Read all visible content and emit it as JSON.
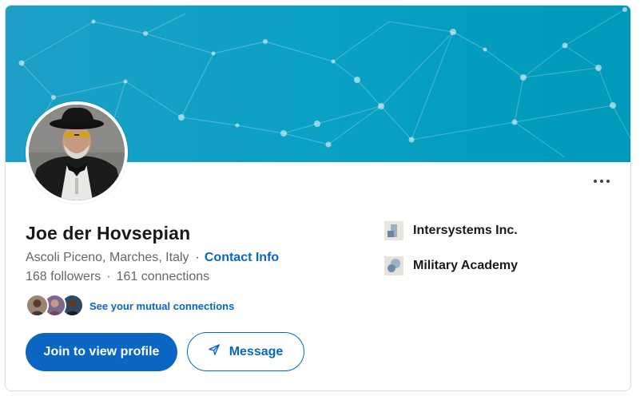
{
  "profile": {
    "name": "Joe der Hovsepian",
    "location": "Ascoli Piceno, Marches, Italy",
    "contact_info_label": "Contact Info",
    "followers": "168 followers",
    "connections": "161 connections",
    "mutual_connections_label": "See your mutual connections"
  },
  "actions": {
    "join_label": "Join to view profile",
    "message_label": "Message",
    "more_label": "More"
  },
  "organizations": [
    {
      "name": "Intersystems Inc.",
      "icon": "company-logo-icon"
    },
    {
      "name": "Military Academy",
      "icon": "school-logo-icon"
    }
  ],
  "colors": {
    "brand_blue": "#0a66c2",
    "banner": "#0aa1c4",
    "text_primary": "#191919",
    "text_secondary": "#666666"
  }
}
